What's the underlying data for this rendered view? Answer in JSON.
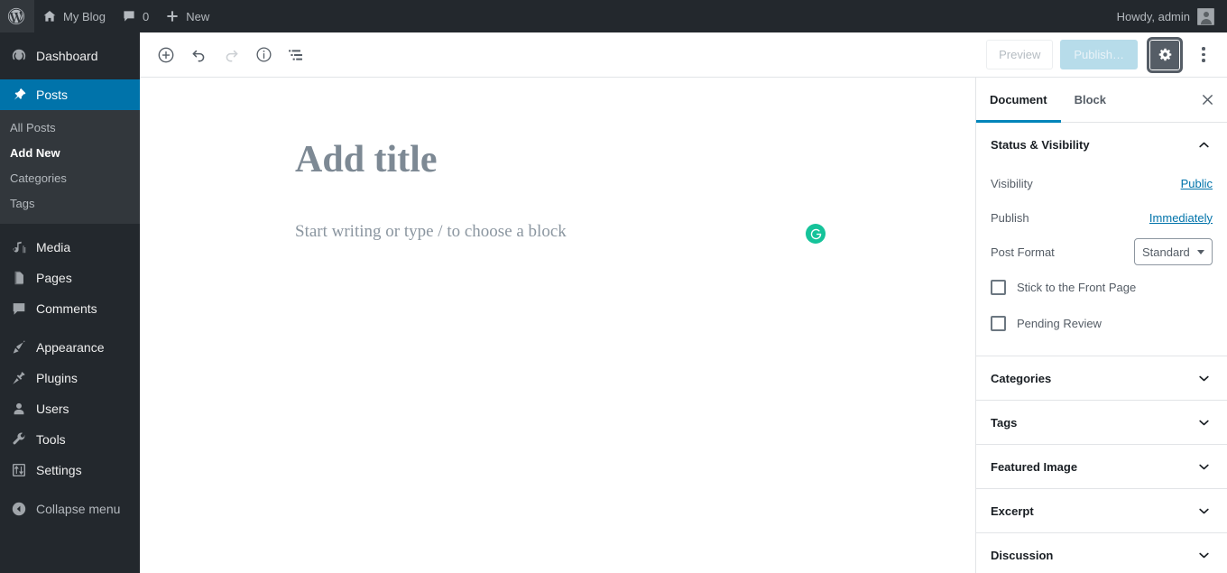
{
  "adminbar": {
    "logo_icon": "wordpress-logo-icon",
    "site_name": "My Blog",
    "site_icon": "home-icon",
    "comments_icon": "comment-bubble-icon",
    "comments_count": "0",
    "new_icon": "plus-icon",
    "new_label": "New",
    "howdy": "Howdy, admin",
    "avatar_icon": "user-avatar-icon"
  },
  "adminmenu": {
    "items": [
      {
        "label": "Dashboard",
        "icon": "dashboard-gauge-icon",
        "key": "dashboard",
        "current": false
      },
      {
        "label": "Posts",
        "icon": "pin-icon",
        "key": "posts",
        "current": true
      },
      {
        "label": "Media",
        "icon": "media-icon",
        "key": "media",
        "current": false
      },
      {
        "label": "Pages",
        "icon": "pages-icon",
        "key": "pages",
        "current": false
      },
      {
        "label": "Comments",
        "icon": "comment-bubble-icon",
        "key": "comments",
        "current": false
      },
      {
        "label": "Appearance",
        "icon": "paintbrush-icon",
        "key": "appearance",
        "current": false
      },
      {
        "label": "Plugins",
        "icon": "plug-icon",
        "key": "plugins",
        "current": false
      },
      {
        "label": "Users",
        "icon": "user-icon",
        "key": "users",
        "current": false
      },
      {
        "label": "Tools",
        "icon": "wrench-icon",
        "key": "tools",
        "current": false
      },
      {
        "label": "Settings",
        "icon": "sliders-icon",
        "key": "settings",
        "current": false
      }
    ],
    "submenu": [
      {
        "label": "All Posts",
        "current": false
      },
      {
        "label": "Add New",
        "current": true
      },
      {
        "label": "Categories",
        "current": false
      },
      {
        "label": "Tags",
        "current": false
      }
    ],
    "collapse": {
      "label": "Collapse menu",
      "icon": "collapse-arrow-icon"
    }
  },
  "toolbar": {
    "add_block_icon": "plus-circle-icon",
    "undo_icon": "undo-arrow-icon",
    "redo_icon": "redo-arrow-icon",
    "info_icon": "info-circle-icon",
    "list_view_icon": "list-view-icon",
    "preview_label": "Preview",
    "publish_label": "Publish…",
    "settings_gear_icon": "gear-icon",
    "more_menu_icon": "kebab-menu-icon"
  },
  "canvas": {
    "title_placeholder": "Add title",
    "paragraph_placeholder": "Start writing or type / to choose a block",
    "grammarly_icon": "grammarly-g-icon"
  },
  "sidebar": {
    "tabs": [
      {
        "label": "Document",
        "active": true
      },
      {
        "label": "Block",
        "active": false
      }
    ],
    "close_icon": "close-x-icon",
    "status_panel": {
      "title": "Status & Visibility",
      "expanded": true,
      "chevron_icon": "chevron-up-icon",
      "visibility_label": "Visibility",
      "visibility_value": "Public",
      "publish_label": "Publish",
      "publish_value": "Immediately",
      "post_format_label": "Post Format",
      "post_format_value": "Standard",
      "post_format_options": [
        "Standard"
      ],
      "sticky_label": "Stick to the Front Page",
      "sticky_checked": false,
      "pending_label": "Pending Review",
      "pending_checked": false
    },
    "panels": [
      {
        "title": "Categories",
        "chevron_icon": "chevron-down-icon"
      },
      {
        "title": "Tags",
        "chevron_icon": "chevron-down-icon"
      },
      {
        "title": "Featured Image",
        "chevron_icon": "chevron-down-icon"
      },
      {
        "title": "Excerpt",
        "chevron_icon": "chevron-down-icon"
      },
      {
        "title": "Discussion",
        "chevron_icon": "chevron-down-icon"
      }
    ]
  },
  "colors": {
    "admin_dark": "#23282d",
    "admin_submenu": "#32373c",
    "accent_blue": "#0073aa",
    "tab_underline": "#0085ba",
    "grammarly_green": "#15c39a",
    "publish_disabled": "#b7dcea"
  }
}
